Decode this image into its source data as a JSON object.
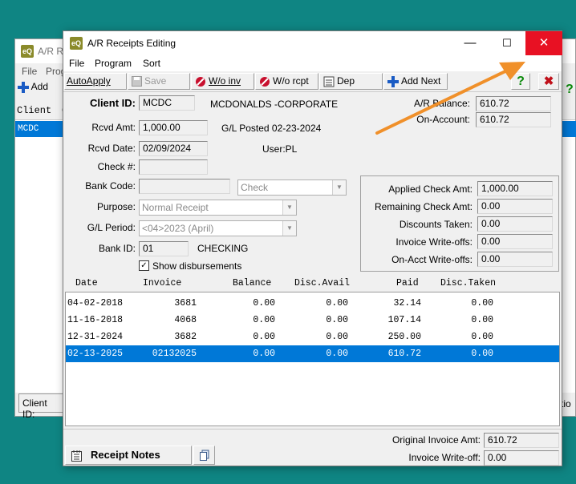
{
  "background_window": {
    "title": "A/R R",
    "menu_file": "File",
    "menu_prog": "Prog",
    "add_label": "Add",
    "col_client": "Client",
    "col_c": "C",
    "row_client": "MCDC",
    "footer_client_id": "Client ID:",
    "footer_right_text": "tio"
  },
  "window": {
    "title": "A/R Receipts Editing",
    "icon_text": "eQ",
    "minimize_symbol": "—",
    "maximize_symbol": "☐",
    "close_symbol": "✕",
    "close_color": "#e81123"
  },
  "menu": [
    "File",
    "Program",
    "Sort"
  ],
  "toolbar": {
    "autoapply": "AutoApply",
    "save": "Save",
    "wo_inv": "W/o inv",
    "wo_rcpt": "W/o rcpt",
    "dep": "Dep",
    "add_next": "Add Next",
    "help_symbol": "?",
    "exit_symbol": "✖"
  },
  "form": {
    "client_id_label": "Client ID:",
    "client_id": "MCDC",
    "client_name": "MCDONALDS -CORPORATE",
    "ar_balance_label": "A/R Balance:",
    "ar_balance": "610.72",
    "on_account_label": "On-Account:",
    "on_account": "610.72",
    "rcvd_amt_label": "Rcvd Amt:",
    "rcvd_amt": "1,000.00",
    "gl_posted": "G/L Posted 02-23-2024",
    "rcvd_date_label": "Rcvd Date:",
    "rcvd_date": "02/09/2024",
    "user": "User:PL",
    "check_no_label": "Check #:",
    "check_no": "",
    "bank_code_label": "Bank Code:",
    "bank_code": "",
    "pay_type": "Check",
    "purpose_label": "Purpose:",
    "purpose": "Normal Receipt",
    "gl_period_label": "G/L Period:",
    "gl_period": "<04>2023 (April)",
    "bank_id_label": "Bank ID:",
    "bank_id": "01",
    "bank_name": "CHECKING",
    "show_disb_label": "Show disbursements",
    "show_disb_check": "✓"
  },
  "summary": {
    "applied_label": "Applied Check Amt:",
    "applied": "1,000.00",
    "remaining_label": "Remaining Check Amt:",
    "remaining": "0.00",
    "discounts_label": "Discounts Taken:",
    "discounts": "0.00",
    "inv_wo_label": "Invoice Write-offs:",
    "inv_wo": "0.00",
    "onacct_wo_label": "On-Acct Write-offs:",
    "onacct_wo": "0.00"
  },
  "table": {
    "headers": [
      "Date",
      "Invoice",
      "Balance",
      "Disc.Avail",
      "Paid",
      "Disc.Taken"
    ],
    "rows": [
      [
        "04-02-2018",
        "3681",
        "0.00",
        "0.00",
        "32.14",
        "0.00"
      ],
      [
        "11-16-2018",
        "4068",
        "0.00",
        "0.00",
        "107.14",
        "0.00"
      ],
      [
        "12-31-2024",
        "3682",
        "0.00",
        "0.00",
        "250.00",
        "0.00"
      ],
      [
        "02-13-2025",
        "02132025",
        "0.00",
        "0.00",
        "610.72",
        "0.00"
      ]
    ],
    "selected_row": 3
  },
  "footer": {
    "receipt_notes": "Receipt Notes",
    "orig_inv_label": "Original Invoice Amt:",
    "orig_inv": "610.72",
    "inv_wo_label": "Invoice Write-off:",
    "inv_wo": "0.00"
  },
  "colors": {
    "accent": "#0078d7",
    "annotation_arrow": "#f0902a",
    "desktop": "#0f8583"
  }
}
